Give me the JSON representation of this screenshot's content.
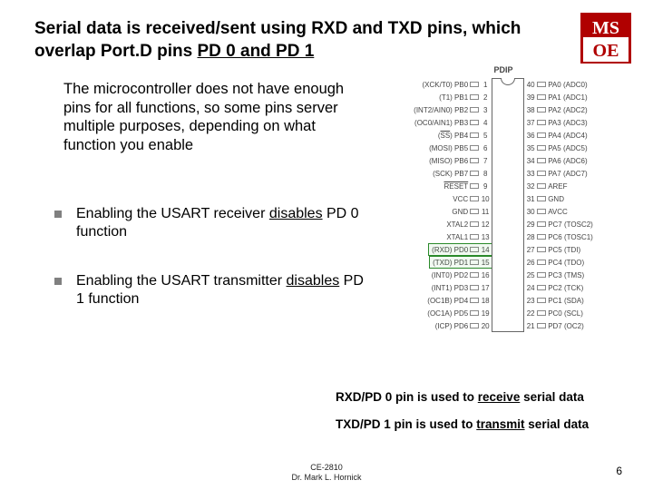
{
  "title_a": "Serial data is received/sent using  RXD and TXD pins, which overlap Port.D pins ",
  "title_b": "PD 0 and PD 1",
  "logo": {
    "top": "MS",
    "bot": "OE"
  },
  "intro": "The microcontroller does not have enough pins for all functions, so some pins server multiple purposes, depending on what function you enable",
  "bullets": [
    {
      "pre": "Enabling the USART receiver ",
      "u": "disables",
      "post": " PD 0 function"
    },
    {
      "pre": "Enabling the USART transmitter ",
      "u": "disables",
      "post": " PD 1 function"
    }
  ],
  "caption1": {
    "a": "RXD/PD 0 pin is used to ",
    "u": "receive",
    "b": " serial data"
  },
  "caption2": {
    "a": "TXD/PD 1 pin is used to ",
    "u": "transmit",
    "b": " serial data"
  },
  "footer": {
    "line1": "CE-2810",
    "line2": "Dr. Mark L. Hornick"
  },
  "pagenum": "6",
  "pinout": {
    "header": "PDIP",
    "left": [
      "(XCK/T0)  PB0",
      "(T1)  PB1",
      "(INT2/AIN0)  PB2",
      "(OC0/AIN1)  PB3",
      "(SS)  PB4",
      "(MOSI)  PB5",
      "(MISO)  PB6",
      "(SCK)  PB7",
      "RESET",
      "VCC",
      "GND",
      "XTAL2",
      "XTAL1",
      "(RXD)  PD0",
      "(TXD)  PD1",
      "(INT0)  PD2",
      "(INT1)  PD3",
      "(OC1B)  PD4",
      "(OC1A)  PD5",
      "(ICP)  PD6"
    ],
    "left_nums": [
      "1",
      "2",
      "3",
      "4",
      "5",
      "6",
      "7",
      "8",
      "9",
      "10",
      "11",
      "12",
      "13",
      "14",
      "15",
      "16",
      "17",
      "18",
      "19",
      "20"
    ],
    "right": [
      "PA0  (ADC0)",
      "PA1  (ADC1)",
      "PA2  (ADC2)",
      "PA3  (ADC3)",
      "PA4  (ADC4)",
      "PA5  (ADC5)",
      "PA6  (ADC6)",
      "PA7  (ADC7)",
      "AREF",
      "GND",
      "AVCC",
      "PC7  (TOSC2)",
      "PC6  (TOSC1)",
      "PC5  (TDI)",
      "PC4  (TDO)",
      "PC3  (TMS)",
      "PC2  (TCK)",
      "PC1  (SDA)",
      "PC0  (SCL)",
      "PD7  (OC2)"
    ],
    "right_nums": [
      "40",
      "39",
      "38",
      "37",
      "36",
      "35",
      "34",
      "33",
      "32",
      "31",
      "30",
      "29",
      "28",
      "27",
      "26",
      "25",
      "24",
      "23",
      "22",
      "21"
    ],
    "overline_left_idx": 4,
    "overline_reset_idx": 8,
    "highlight_rows": [
      13,
      14
    ]
  }
}
